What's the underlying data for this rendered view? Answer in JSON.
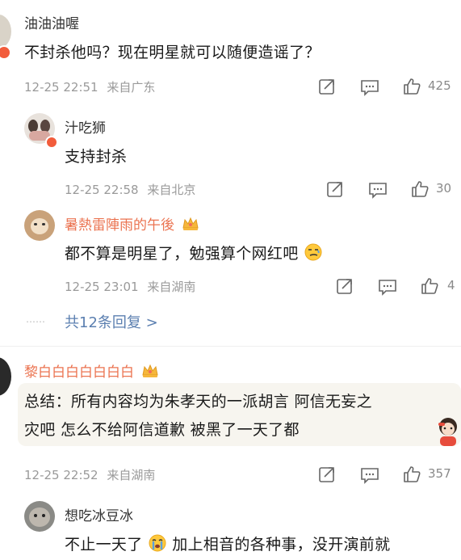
{
  "comments": [
    {
      "username": "油油油喔",
      "text": "不封杀他吗？现在明星就可以随便造谣了？",
      "timestamp": "12-25 22:51",
      "location": "来自广东",
      "likes": "425",
      "replies": [
        {
          "username": "汁吃狮",
          "text": "支持封杀",
          "timestamp": "12-25 22:58",
          "location": "来自北京",
          "likes": "30"
        },
        {
          "username": "暑熱雷陣雨的午後",
          "text": "都不算是明星了，勉强算个网红吧",
          "timestamp": "12-25 23:01",
          "location": "来自湖南",
          "likes": "4"
        }
      ],
      "more_replies": "共12条回复 >",
      "more_dots": "……"
    },
    {
      "username": "黎白白白白白白白",
      "text_line1": "总结：所有内容均为朱孝天的一派胡言 阿信无妄之",
      "text_line2": "灾吧 怎么不给阿信道歉 被黑了一天了都",
      "timestamp": "12-25 22:52",
      "location": "来自湖南",
      "likes": "357",
      "replies": [
        {
          "username": "想吃冰豆冰",
          "text_before": "不止一天了",
          "text_after": "加上相音的各种事，没开演前就"
        }
      ]
    }
  ],
  "colors": {
    "vip_name": "#eb7350",
    "link": "#5b7fb0",
    "meta": "#9a9a9a"
  }
}
